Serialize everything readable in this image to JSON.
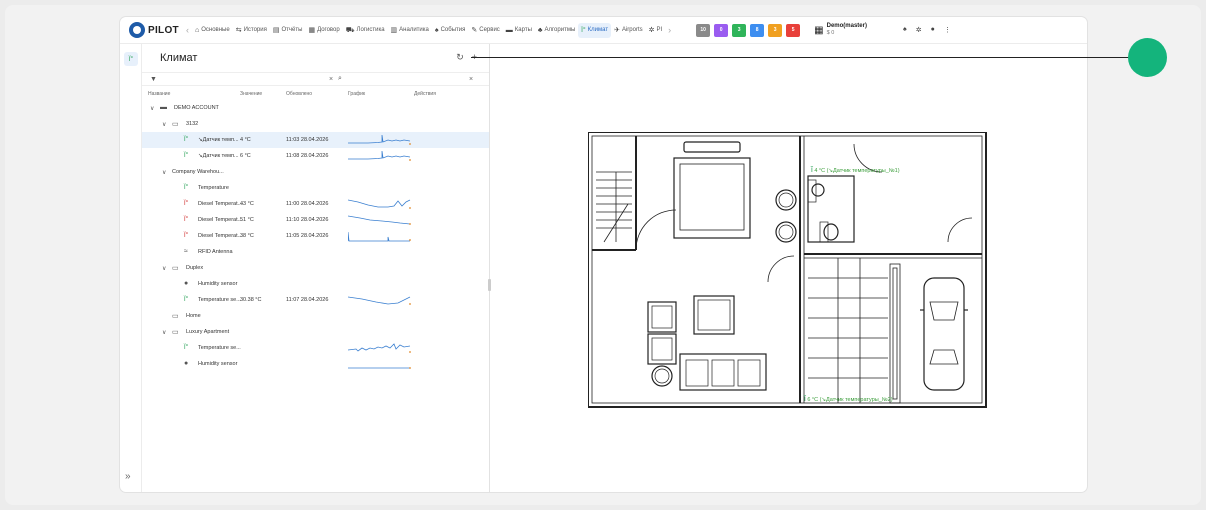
{
  "app": {
    "logo_text": "PILOT",
    "nav": [
      {
        "icon": "home-icon",
        "glyph": "⌂",
        "label": "Основные",
        "active": false
      },
      {
        "icon": "history-icon",
        "glyph": "⇆",
        "label": "История",
        "active": false
      },
      {
        "icon": "report-icon",
        "glyph": "▤",
        "label": "Отчёты",
        "active": false
      },
      {
        "icon": "contract-icon",
        "glyph": "▦",
        "label": "Договор",
        "active": false
      },
      {
        "icon": "truck-icon",
        "glyph": "⛟",
        "label": "Логистика",
        "active": false
      },
      {
        "icon": "analytics-icon",
        "glyph": "▥",
        "label": "Аналитика",
        "active": false
      },
      {
        "icon": "bell-icon",
        "glyph": "♠",
        "label": "События",
        "active": false
      },
      {
        "icon": "wrench-icon",
        "glyph": "✎",
        "label": "Сервис",
        "active": false
      },
      {
        "icon": "map-icon",
        "glyph": "▬",
        "label": "Карты",
        "active": false
      },
      {
        "icon": "algorithm-icon",
        "glyph": "♣",
        "label": "Алгоритмы",
        "active": false
      },
      {
        "icon": "thermometer-icon",
        "glyph": "ǐ°",
        "label": "Климат",
        "active": true
      },
      {
        "icon": "airplane-icon",
        "glyph": "✈",
        "label": "Airports",
        "active": false
      },
      {
        "icon": "gear-icon",
        "glyph": "✲",
        "label": "PI",
        "active": false
      }
    ],
    "badges": [
      {
        "value": "10",
        "color": "#8a8a8a"
      },
      {
        "value": "0",
        "color": "#9a5cf0"
      },
      {
        "value": "3",
        "color": "#2fb45a"
      },
      {
        "value": "8",
        "color": "#3d8ef0"
      },
      {
        "value": "3",
        "color": "#f0a020"
      },
      {
        "value": "5",
        "color": "#e8403a"
      }
    ],
    "user": {
      "name": "Demo(master)",
      "balance": "$ 0"
    }
  },
  "panel": {
    "title": "Климат",
    "search_placeholder": "",
    "columns": {
      "name": "Название",
      "value": "Значение",
      "updated": "Обновлено",
      "chart": "График",
      "actions": "Действия"
    },
    "rows": [
      {
        "level": 0,
        "chev": "∨",
        "icon": "folder-icon",
        "glyph": "▬",
        "label": "DEMO ACCOUNT",
        "value": "",
        "updated": "",
        "spark": "",
        "selected": false
      },
      {
        "level": 1,
        "chev": "∨",
        "icon": "building-icon",
        "glyph": "▭",
        "label": "3132",
        "value": "",
        "updated": "",
        "spark": "",
        "selected": false
      },
      {
        "level": 2,
        "chev": "",
        "icon": "thermometer-icon",
        "glyph": "ǐ°",
        "label": "↘Датчик темп...",
        "value": "4 °C",
        "updated": "11:03 28.04.2026",
        "spark": "spike",
        "selected": true
      },
      {
        "level": 2,
        "chev": "",
        "icon": "thermometer-icon",
        "glyph": "ǐ°",
        "label": "↘Датчик темп...",
        "value": "6 °C",
        "updated": "11:08 28.04.2026",
        "spark": "spike",
        "selected": false
      },
      {
        "level": 1,
        "chev": "∨",
        "icon": "none",
        "glyph": "",
        "label": "Company Warehou...",
        "value": "",
        "updated": "",
        "spark": "",
        "selected": false
      },
      {
        "level": 2,
        "chev": "",
        "icon": "thermometer-icon",
        "glyph": "ǐ°",
        "label": "Temperature",
        "value": "",
        "updated": "",
        "spark": "",
        "selected": false
      },
      {
        "level": 2,
        "chev": "",
        "icon": "thermometer-icon",
        "glyph": "ǐ°",
        "label": "Diesel Temperat...",
        "value": "43 °C",
        "updated": "11:00 28.04.2026",
        "spark": "dip",
        "selected": false
      },
      {
        "level": 2,
        "chev": "",
        "icon": "thermometer-icon",
        "glyph": "ǐ°",
        "label": "Diesel Temperat...",
        "value": "51 °C",
        "updated": "11:10 28.04.2026",
        "spark": "decline",
        "selected": false
      },
      {
        "level": 2,
        "chev": "",
        "icon": "thermometer-icon",
        "glyph": "ǐ°",
        "label": "Diesel Temperat...",
        "value": "38 °C",
        "updated": "11:05 28.04.2026",
        "spark": "step",
        "selected": false
      },
      {
        "level": 2,
        "chev": "",
        "icon": "antenna-icon",
        "glyph": "≈",
        "label": "RFID Antenna",
        "value": "",
        "updated": "",
        "spark": "",
        "selected": false
      },
      {
        "level": 1,
        "chev": "∨",
        "icon": "building-icon",
        "glyph": "▭",
        "label": "Duplex",
        "value": "",
        "updated": "",
        "spark": "",
        "selected": false
      },
      {
        "level": 2,
        "chev": "",
        "icon": "droplet-icon",
        "glyph": "●",
        "label": "Humidity sensor",
        "value": "",
        "updated": "",
        "spark": "",
        "selected": false
      },
      {
        "level": 2,
        "chev": "",
        "icon": "thermometer-icon",
        "glyph": "ǐ°",
        "label": "Temperature se...",
        "value": "30.38 °C",
        "updated": "11:07 28.04.2026",
        "spark": "valley",
        "selected": false
      },
      {
        "level": 1,
        "chev": "",
        "icon": "building-icon",
        "glyph": "▭",
        "label": "Home",
        "value": "",
        "updated": "",
        "spark": "",
        "selected": false
      },
      {
        "level": 1,
        "chev": "∨",
        "icon": "building-icon",
        "glyph": "▭",
        "label": "Luxury Apartment",
        "value": "",
        "updated": "",
        "spark": "",
        "selected": false
      },
      {
        "level": 2,
        "chev": "",
        "icon": "thermometer-icon",
        "glyph": "ǐ°",
        "label": "Temperature se...",
        "value": "",
        "updated": "",
        "spark": "noisy",
        "selected": false
      },
      {
        "level": 2,
        "chev": "",
        "icon": "droplet-icon",
        "glyph": "●",
        "label": "Humidity sensor",
        "value": "",
        "updated": "",
        "spark": "flat",
        "selected": false
      }
    ]
  },
  "plan": {
    "sensor1": "4 °C (↘Датчик температуры_№1)",
    "sensor2": "6 °C (↘Датчик температуры_№2)"
  },
  "colors": {
    "accent": "#2b6cc4",
    "green": "#2ea35b",
    "callout": "#14b47c",
    "red": "#d23a3a"
  }
}
